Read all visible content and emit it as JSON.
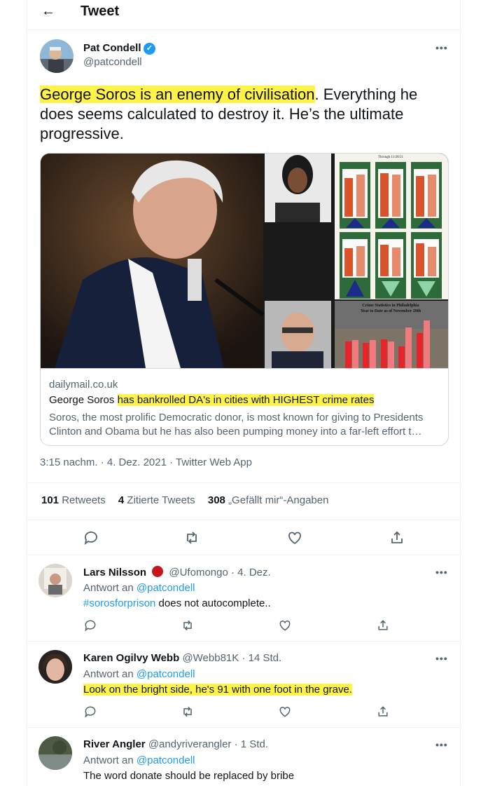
{
  "header": {
    "back_icon": "arrow-left-icon",
    "title": "Tweet"
  },
  "tweet": {
    "author_name": "Pat Condell",
    "author_handle": "@patcondell",
    "text_highlighted": "George Soros is an enemy of civilisation",
    "text_rest": ". Everything he does seems calculated to destroy it. He’s the ultimate progressive.",
    "card": {
      "domain": "dailymail.co.uk",
      "title_start": "George Soros ",
      "title_highlighted": "has bankrolled DA's in cities with HIGHEST crime rates",
      "description": "Soros, the most prolific Democratic donor, is most known for giving to Presidents Clinton and Obama but he has also been pumping money into a far-left effort t…",
      "chart_caption_1": "Through 11/28/21",
      "chart_caption_2": "Crime Statistics in Philadelphia",
      "chart_caption_3": "Year to Date as of November 29th"
    },
    "timestamp": "3:15 nachm. · 4. Dez. 2021 · Twitter Web App",
    "stats": {
      "retweets_count": "101",
      "retweets_label": " Retweets",
      "quotes_count": "4",
      "quotes_label": " Zitierte Tweets",
      "likes_count": "308",
      "likes_label": " „Gefällt mir“-Angaben"
    }
  },
  "replies": [
    {
      "name": "Lars Nilsson",
      "handle": "@Ufomongo · 4. Dez.",
      "reply_prefix": "Antwort an ",
      "reply_to": "@patcondell",
      "hashtag": "#sorosforprison",
      "text": " does not autocomplete.."
    },
    {
      "name": "Karen Ogilvy Webb",
      "handle": "@Webb81K · 14 Std.",
      "reply_prefix": "Antwort an ",
      "reply_to": "@patcondell",
      "text": "Look on the bright side, he's 91 with one foot in the grave."
    },
    {
      "name": "River Angler",
      "handle": "@andyriverangler · 1 Std.",
      "reply_prefix": "Antwort an ",
      "reply_to": "@patcondell",
      "text": "The word donate should be replaced by bribe"
    }
  ],
  "colors": {
    "accent": "#1d9bf0",
    "highlight": "#fff34a",
    "secondary_text": "#536471"
  }
}
